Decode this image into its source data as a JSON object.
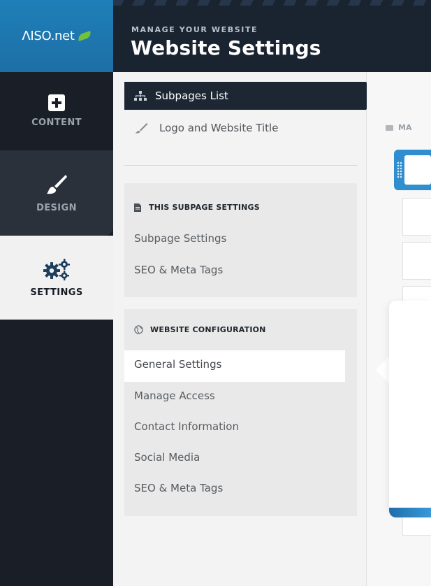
{
  "logo": {
    "text": "ΛISO.net"
  },
  "header": {
    "eyebrow": "MANAGE YOUR WEBSITE",
    "title": "Website Settings"
  },
  "left_nav": {
    "items": [
      {
        "label": "CONTENT",
        "icon": "plus-square-icon"
      },
      {
        "label": "DESIGN",
        "icon": "brush-icon"
      },
      {
        "label": "SETTINGS",
        "icon": "gears-icon",
        "active": true
      }
    ]
  },
  "sub_sidebar": {
    "top_items": [
      {
        "label": "Subpages List",
        "icon": "sitemap-icon",
        "active": true
      },
      {
        "label": "Logo and Website Title",
        "icon": "pencil-icon"
      }
    ],
    "this_subpage": {
      "title": "THIS SUBPAGE SETTINGS",
      "links": [
        "Subpage Settings",
        "SEO & Meta Tags"
      ]
    },
    "website_config": {
      "title": "WEBSITE CONFIGURATION",
      "links": [
        "General Settings",
        "Manage Access",
        "Contact Information",
        "Social Media",
        "SEO & Meta Tags"
      ],
      "highlighted": "General Settings"
    }
  },
  "content": {
    "breadcrumb": "MA"
  },
  "colors": {
    "brand_blue": "#1f7fb8",
    "header_dark": "#1a2330",
    "nav_dark": "#1a1f27",
    "leaf_green": "#6fc23a",
    "row_blue": "#2e8ed0"
  }
}
